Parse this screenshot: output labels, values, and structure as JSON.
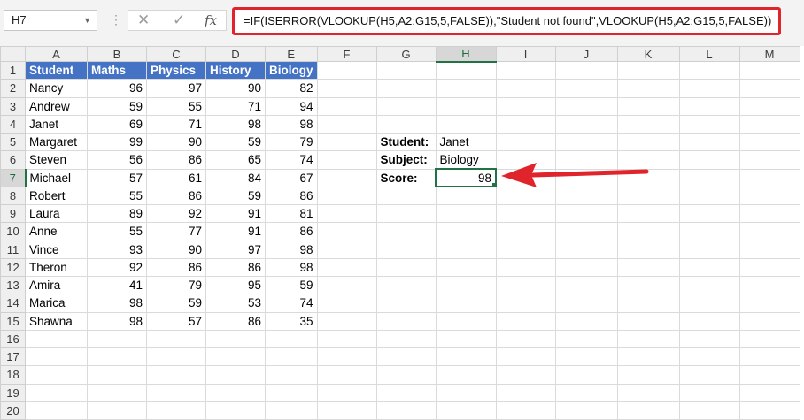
{
  "name_box": "H7",
  "formula": "=IF(ISERROR(VLOOKUP(H5,A2:G15,5,FALSE)),\"Student not found\",VLOOKUP(H5,A2:G15,5,FALSE))",
  "icons": {
    "cancel": "✕",
    "enter": "✓",
    "fx": "fx",
    "caret": "▼",
    "dots": "⋮"
  },
  "columns": [
    "A",
    "B",
    "C",
    "D",
    "E",
    "F",
    "G",
    "H",
    "I",
    "J",
    "K",
    "L",
    "M"
  ],
  "headers": [
    "Student",
    "Maths",
    "Physics",
    "History",
    "Biology"
  ],
  "students": [
    {
      "row": "2",
      "name": "Nancy",
      "maths": "96",
      "physics": "97",
      "history": "90",
      "biology": "82"
    },
    {
      "row": "3",
      "name": "Andrew",
      "maths": "59",
      "physics": "55",
      "history": "71",
      "biology": "94"
    },
    {
      "row": "4",
      "name": "Janet",
      "maths": "69",
      "physics": "71",
      "history": "98",
      "biology": "98"
    },
    {
      "row": "5",
      "name": "Margaret",
      "maths": "99",
      "physics": "90",
      "history": "59",
      "biology": "79"
    },
    {
      "row": "6",
      "name": "Steven",
      "maths": "56",
      "physics": "86",
      "history": "65",
      "biology": "74"
    },
    {
      "row": "7",
      "name": "Michael",
      "maths": "57",
      "physics": "61",
      "history": "84",
      "biology": "67"
    },
    {
      "row": "8",
      "name": "Robert",
      "maths": "55",
      "physics": "86",
      "history": "59",
      "biology": "86"
    },
    {
      "row": "9",
      "name": "Laura",
      "maths": "89",
      "physics": "92",
      "history": "91",
      "biology": "81"
    },
    {
      "row": "10",
      "name": "Anne",
      "maths": "55",
      "physics": "77",
      "history": "91",
      "biology": "86"
    },
    {
      "row": "11",
      "name": "Vince",
      "maths": "93",
      "physics": "90",
      "history": "97",
      "biology": "98"
    },
    {
      "row": "12",
      "name": "Theron",
      "maths": "92",
      "physics": "86",
      "history": "86",
      "biology": "98"
    },
    {
      "row": "13",
      "name": "Amira",
      "maths": "41",
      "physics": "79",
      "history": "95",
      "biology": "59"
    },
    {
      "row": "14",
      "name": "Marica",
      "maths": "98",
      "physics": "59",
      "history": "53",
      "biology": "74"
    },
    {
      "row": "15",
      "name": "Shawna",
      "maths": "98",
      "physics": "57",
      "history": "86",
      "biology": "35"
    }
  ],
  "lookup": {
    "student_label": "Student:",
    "student_value": "Janet",
    "subject_label": "Subject:",
    "subject_value": "Biology",
    "score_label": "Score:",
    "score_value": "98"
  },
  "row_numbers": [
    "1",
    "2",
    "3",
    "4",
    "5",
    "6",
    "7",
    "8",
    "9",
    "10",
    "11",
    "12",
    "13",
    "14",
    "15",
    "16",
    "17",
    "18",
    "19",
    "20"
  ],
  "colors": {
    "header_fill": "#4472c4",
    "highlight": "#e0242b",
    "selection": "#217346"
  }
}
